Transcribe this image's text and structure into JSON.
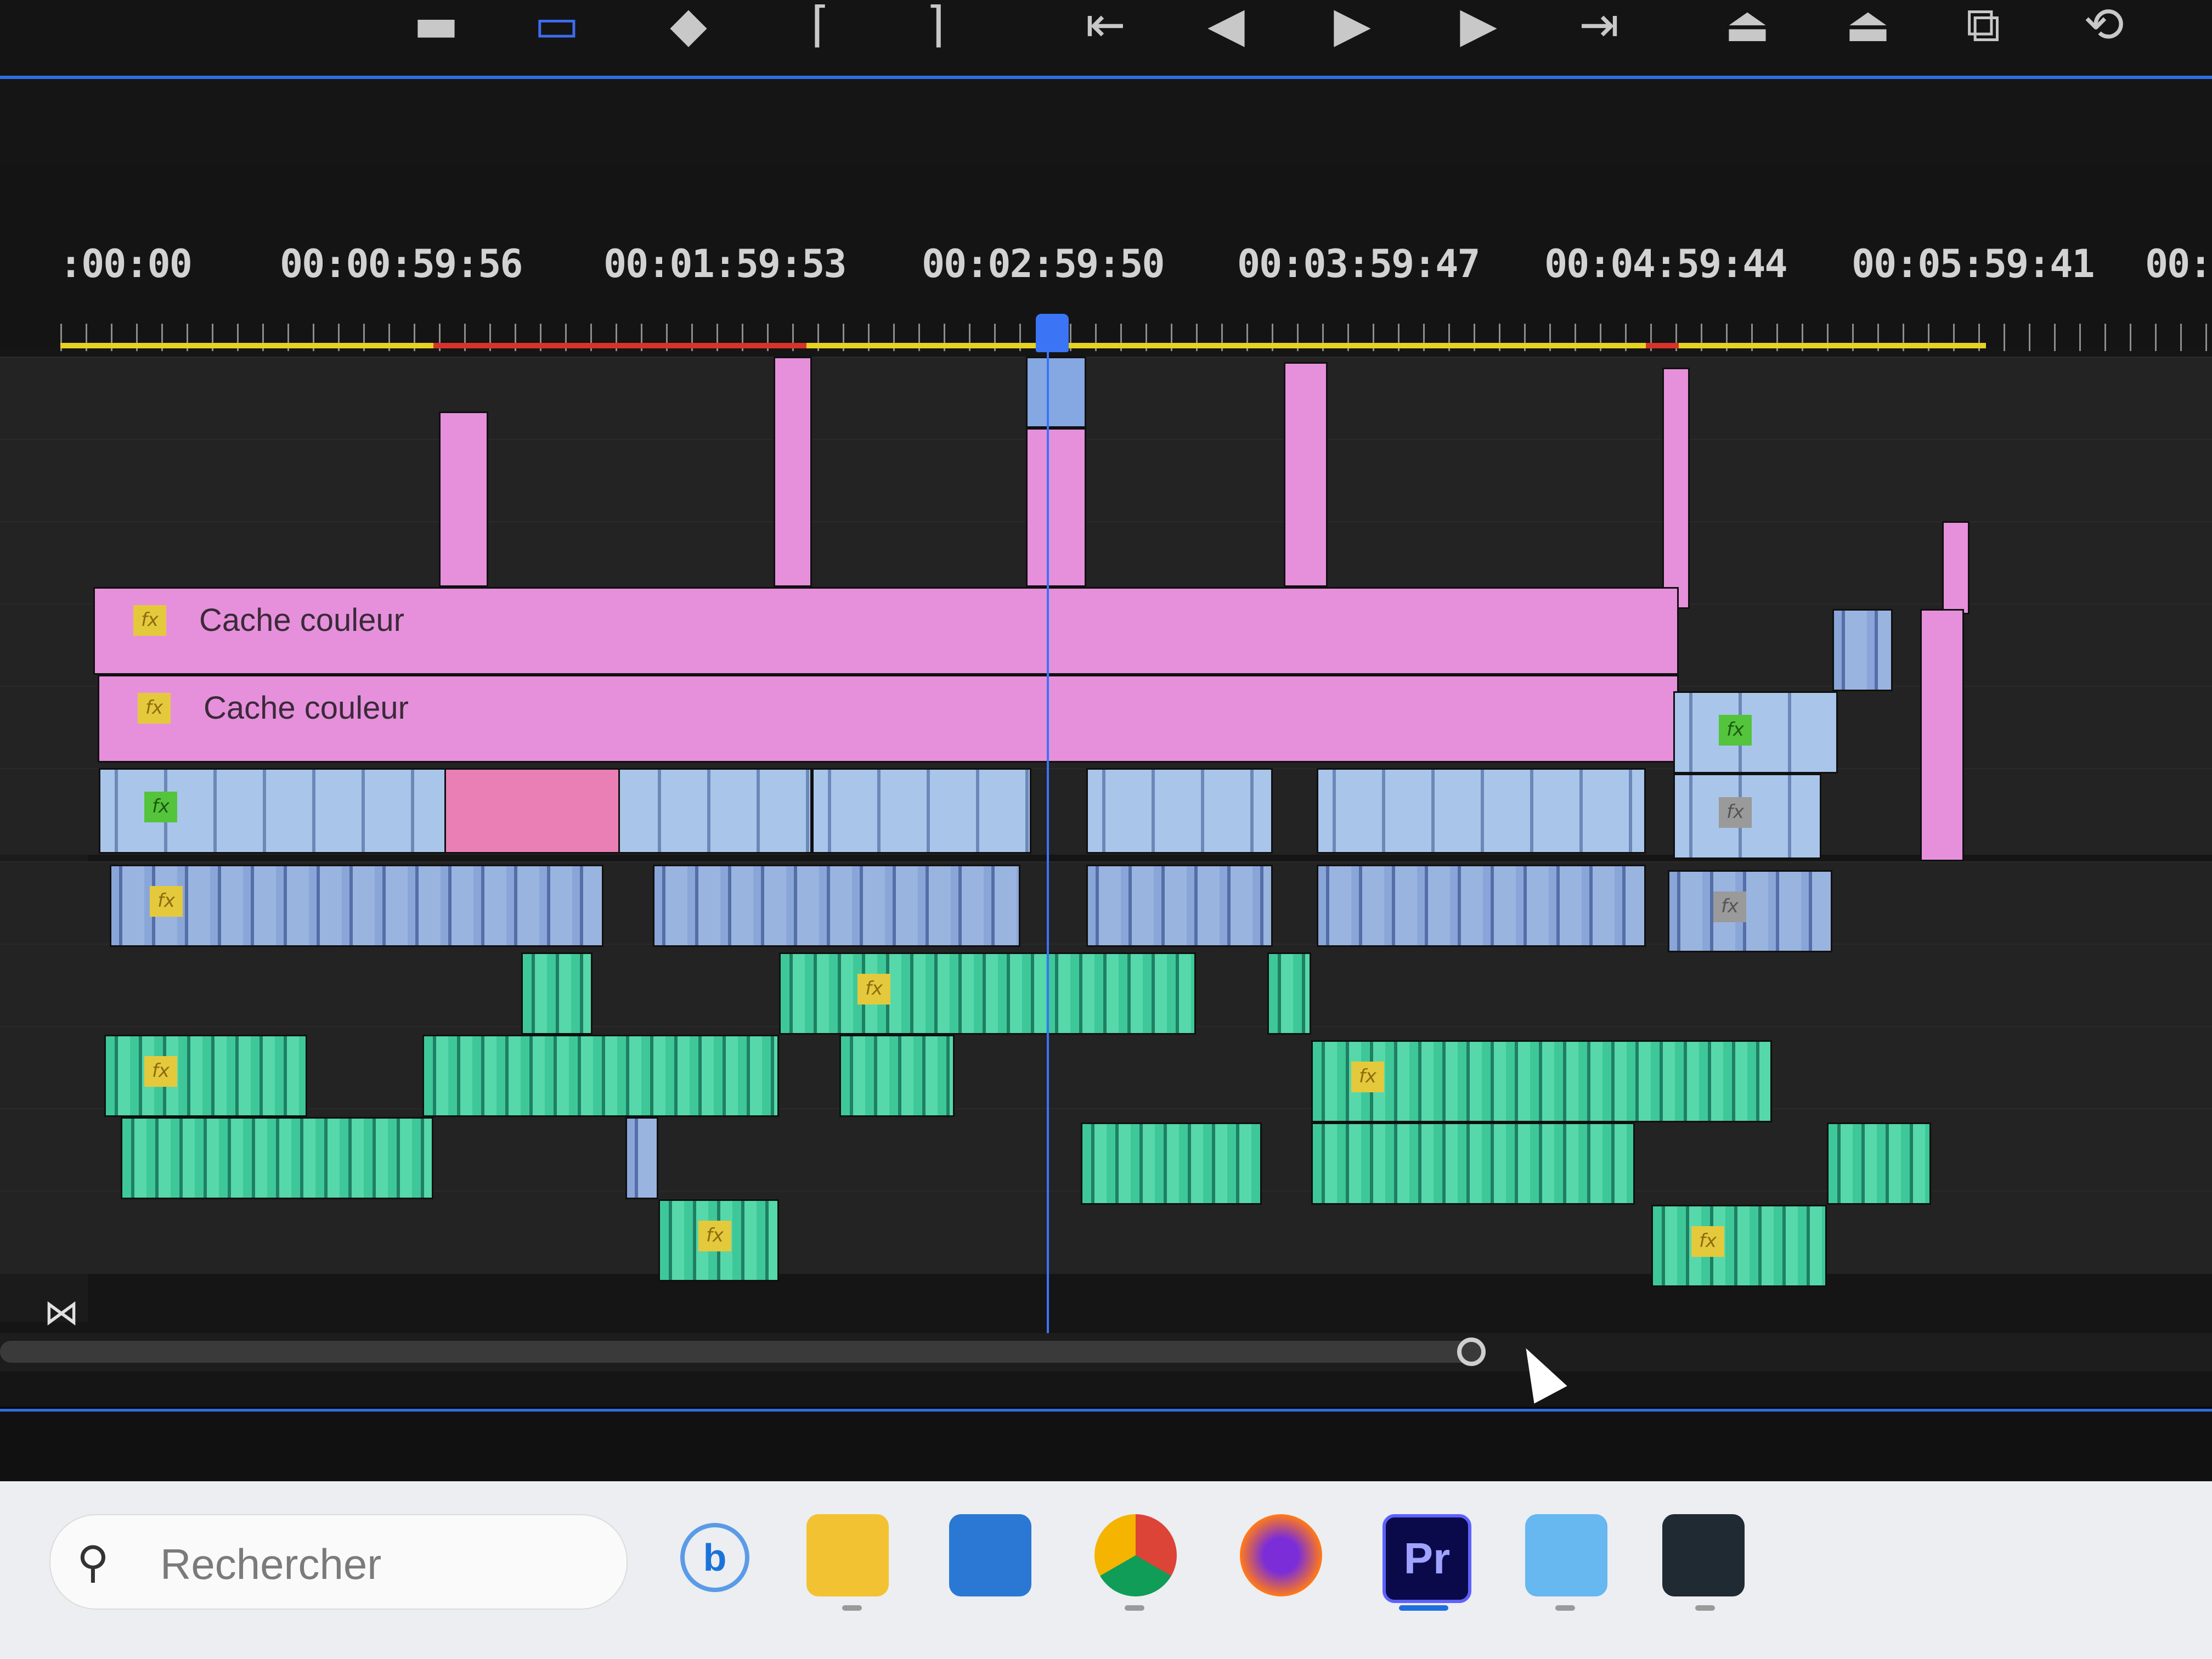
{
  "timecodes": [
    ":00:00",
    "00:00:59:56",
    "00:01:59:53",
    "00:02:59:50",
    "00:03:59:47",
    "00:04:59:44",
    "00:05:59:41",
    "00:0"
  ],
  "clips": {
    "cache_label_1": "Cache couleur",
    "cache_label_2": "Cache couleur",
    "fx_badge": "fx"
  },
  "taskbar": {
    "search_placeholder": "Rechercher",
    "apps": [
      {
        "name": "bing-chat-icon",
        "label": "b"
      },
      {
        "name": "file-explorer-icon",
        "label": ""
      },
      {
        "name": "microsoft-store-icon",
        "label": ""
      },
      {
        "name": "chrome-icon",
        "label": ""
      },
      {
        "name": "firefox-icon",
        "label": ""
      },
      {
        "name": "premiere-pro-icon",
        "label": "Pr"
      },
      {
        "name": "notepad-icon",
        "label": ""
      },
      {
        "name": "audio-app-icon",
        "label": ""
      }
    ]
  },
  "colors": {
    "accent": "#2f6ee0",
    "playhead": "#3b74f5",
    "clip_pink": "#e690dc",
    "clip_blue": "#a9c6ea",
    "clip_green": "#3ec89a"
  }
}
